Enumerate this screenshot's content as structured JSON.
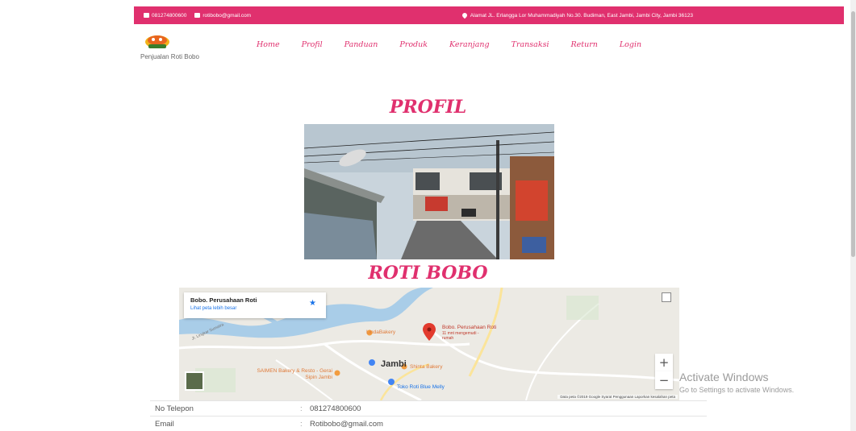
{
  "topbar": {
    "phone": "081274800600",
    "email": "rotibobo@gmail.com",
    "address": "Alamat JL. Erlangga Lor Muhammadiyah No.30. Budiman, East Jambi, Jambi City, Jambi 36123"
  },
  "brand": {
    "name": "Penjualan Roti Bobo"
  },
  "nav": {
    "items": [
      "Home",
      "Profil",
      "Panduan",
      "Produk",
      "Keranjang",
      "Transaksi",
      "Return",
      "Login"
    ]
  },
  "headings": {
    "profil": "PROFIL",
    "roti_bobo": "ROTI BOBO"
  },
  "map": {
    "card_title": "Bobo. Perusahaan Roti",
    "card_link": "Lihat peta lebih besar",
    "pin_title": "Bobo. Perusahaan Roti",
    "pin_sub": "11 mnt mengemudi - rumah",
    "labels": {
      "linda": "LindaBakery",
      "jambi": "Jambi",
      "shinta": "Shinta Bakery",
      "saimen": "SAIMEN Bakery & Resto - Gerai Sipin Jambi",
      "toko": "Toko Roti Blue Melly",
      "road": "Jl. Lingkar Sumatra"
    },
    "zoom_in": "+",
    "zoom_out": "−",
    "credits": "Data peta ©2019 Google   Syarat Penggunaan   Laporkan kesalahan peta"
  },
  "activate": {
    "title": "Activate Windows",
    "subtitle": "Go to Settings to activate Windows."
  },
  "info": {
    "rows": [
      {
        "label": "No Telepon",
        "value": "081274800600"
      },
      {
        "label": "Email",
        "value": "Rotibobo@gmail.com"
      }
    ]
  },
  "colors": {
    "accent": "#e0306e"
  }
}
